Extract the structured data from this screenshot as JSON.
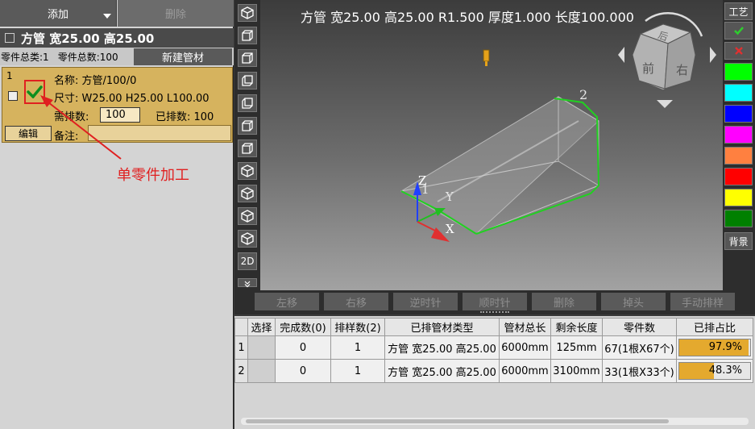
{
  "left_panel": {
    "add_label": "添加",
    "delete_label": "删除",
    "tube_heading": "方管 宽25.00 高25.00",
    "stats": {
      "kinds": "零件总类:1",
      "total": "零件总数:100"
    },
    "new_tube_label": "新建管材",
    "part": {
      "index": "1",
      "name": "名称: 方管/100/0",
      "size": "尺寸: W25.00 H25.00 L100.00",
      "qty_label": "需排数:",
      "qty_value": "100",
      "sorted": "已排数: 100",
      "edit_label": "编辑",
      "note_label": "备注:"
    },
    "annotation": "单零件加工"
  },
  "viewport": {
    "title": "方管 宽25.00 高25.00 R1.500 厚度1.000 长度100.000",
    "axis_z": "Z",
    "axis_y": "Y",
    "axis_x": "X",
    "label_1": "1",
    "label_2": "2",
    "cube_faces": {
      "top": "后",
      "front": "前",
      "right": "右"
    }
  },
  "left_toolbar": {
    "mode_2d": "2D"
  },
  "right_toolbar": {
    "process_label": "工艺",
    "background_label": "背景",
    "swatches": [
      "#00ff00",
      "#00ffff",
      "#0000ff",
      "#ff00ff",
      "#ff8040",
      "#ff0000",
      "#ffff00",
      "#008000"
    ]
  },
  "actions": {
    "left": "左移",
    "right": "右移",
    "ccw": "逆时针",
    "cw": "顺时针",
    "delete": "删除",
    "drop_head": "掉头",
    "manual": "手动排样"
  },
  "table": {
    "headers": [
      "选择",
      "完成数(0)",
      "排样数(2)",
      "已排管材类型",
      "管材总长",
      "剩余长度",
      "零件数",
      "已排占比"
    ],
    "rows": [
      {
        "n": "1",
        "done": "0",
        "count": "1",
        "type": "方管 宽25.00 高25.00",
        "total": "6000mm",
        "remain": "125mm",
        "parts": "67(1根X67个)",
        "ratio_text": "97.9%",
        "ratio": 0.979
      },
      {
        "n": "2",
        "done": "0",
        "count": "1",
        "type": "方管 宽25.00 高25.00",
        "total": "6000mm",
        "remain": "3100mm",
        "parts": "33(1根X33个)",
        "ratio_text": "48.3%",
        "ratio": 0.483
      }
    ]
  },
  "colors": {
    "card_bg": "#d6b35e",
    "annotation": "#e02020",
    "ratio_fill": "#e4a92e",
    "edge_green": "#21d021"
  }
}
